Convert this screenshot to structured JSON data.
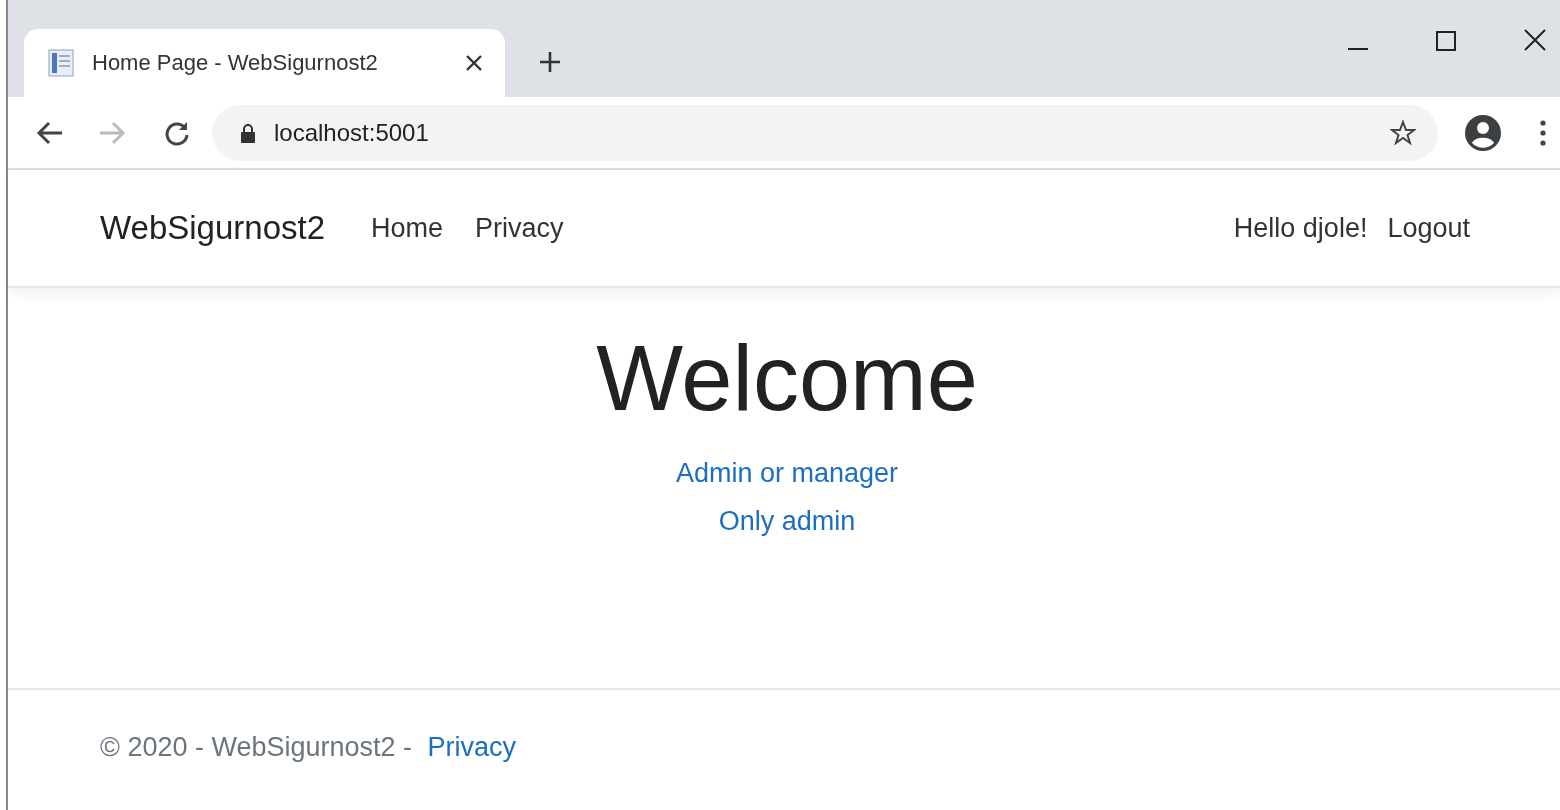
{
  "browser": {
    "tab_title": "Home Page - WebSigurnost2",
    "address": "localhost:5001"
  },
  "navbar": {
    "brand": "WebSigurnost2",
    "links": [
      {
        "label": "Home"
      },
      {
        "label": "Privacy"
      }
    ],
    "greeting": "Hello djole!",
    "logout": "Logout"
  },
  "main": {
    "heading": "Welcome",
    "links": [
      "Admin or manager",
      "Only admin"
    ]
  },
  "footer": {
    "text": "© 2020 - WebSigurnost2 -",
    "link": "Privacy"
  }
}
